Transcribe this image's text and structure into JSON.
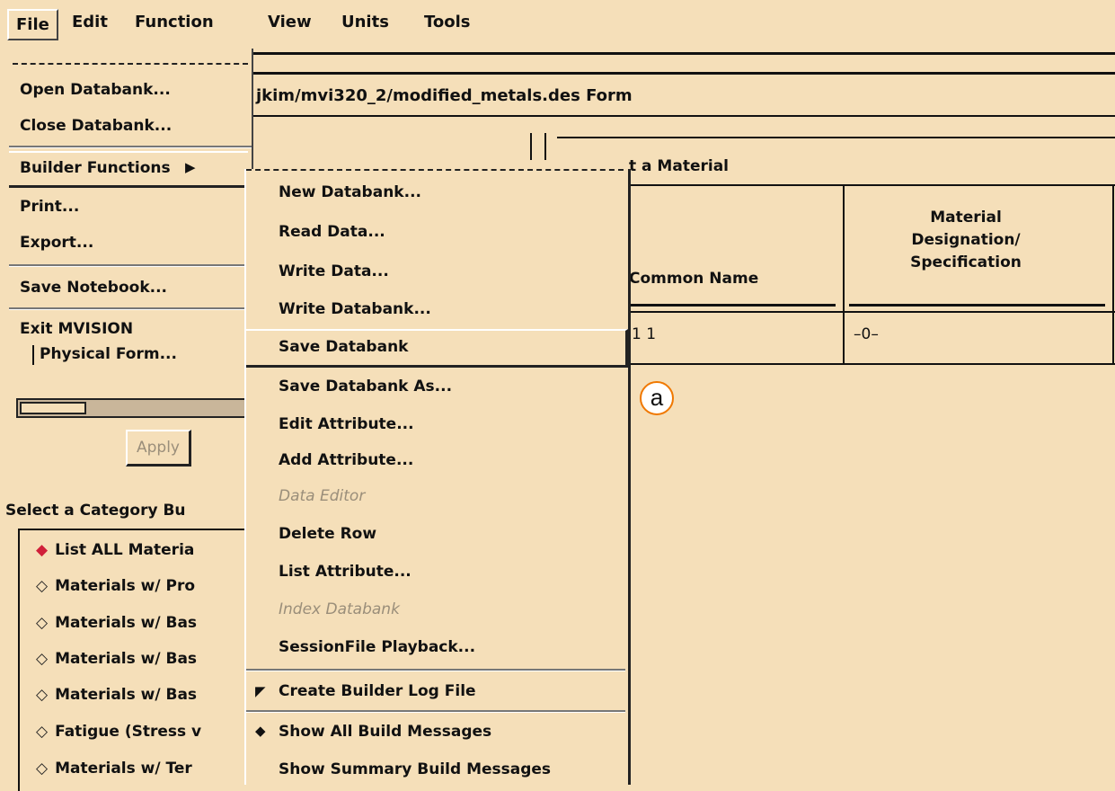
{
  "menubar": {
    "items": [
      "File",
      "Edit",
      "Function",
      "View",
      "Units",
      "Tools"
    ]
  },
  "window": {
    "title": "jkim/mvi320_2/modified_metals.des Form"
  },
  "file_menu": {
    "items": [
      "Open Databank...",
      "Close Databank...",
      "Builder Functions",
      "Print...",
      "Export...",
      "Save Notebook...",
      "Exit MVISION"
    ],
    "cascade_glyph": "▶"
  },
  "builder_submenu": {
    "items": [
      "New Databank...",
      "Read Data...",
      "Write Data...",
      "Write Databank...",
      "Save Databank",
      "Save Databank As...",
      "Edit Attribute...",
      "Add Attribute...",
      "Data Editor",
      "Delete Row",
      "List Attribute...",
      "Index Databank",
      "SessionFile Playback...",
      "Create Builder Log File",
      "Show All Build Messages",
      "Show Summary Build Messages"
    ],
    "disabled": [
      "Data Editor",
      "Index Databank"
    ],
    "checked_glyph": "◤",
    "selected_glyph": "◆"
  },
  "left_panel": {
    "physical_form_button": "Physical Form...",
    "apply_button": "Apply",
    "category_label": "Select a Category Bu",
    "categories": [
      "List ALL Materia",
      "Materials w/ Pro",
      "Materials w/ Bas",
      "Materials w/ Bas",
      "Materials w/ Bas",
      "Fatigue (Stress v",
      "Materials w/ Ter"
    ]
  },
  "table": {
    "title_fragment": "t a Material",
    "headers": [
      "Common Name",
      "Material\nDesignation/\nSpecification"
    ],
    "row": [
      "1 1",
      "–0–"
    ]
  },
  "annotation": {
    "label": "a",
    "color": "#f07800"
  }
}
